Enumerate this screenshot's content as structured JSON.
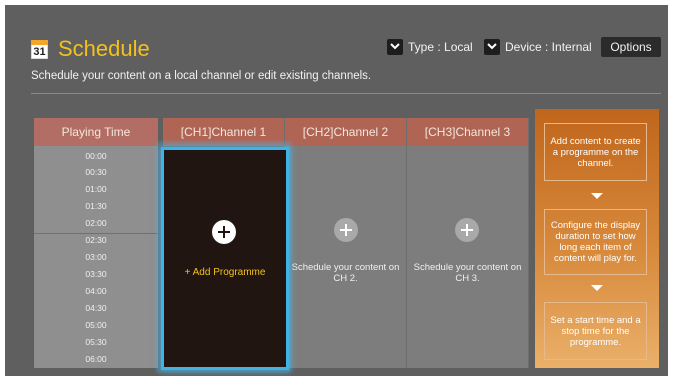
{
  "header": {
    "calendar_day": "31",
    "title": "Schedule",
    "subtitle": "Schedule your content on a local channel or edit existing channels."
  },
  "controls": {
    "type_label": "Type : Local",
    "device_label": "Device : Internal",
    "options_label": "Options"
  },
  "grid": {
    "time_header": "Playing Time",
    "times": [
      "00:00",
      "00:30",
      "01:00",
      "01:30",
      "02:00",
      "02:30",
      "03:00",
      "03:30",
      "04:00",
      "04:30",
      "05:00",
      "05:30",
      "06:00"
    ],
    "channels": [
      {
        "header": "[CH1]Channel 1",
        "text": "+ Add Programme"
      },
      {
        "header": "[CH2]Channel 2",
        "text": "Schedule your content on CH 2."
      },
      {
        "header": "[CH3]Channel 3",
        "text": "Schedule your content on CH 3."
      }
    ]
  },
  "help": {
    "steps": [
      "Add content to create a programme on the channel.",
      "Configure the display duration to set how long each item of content will play for.",
      "Set a start time and a stop time for the programme."
    ]
  },
  "colors": {
    "title": "#f2c11c",
    "background": "#5f5f5f",
    "selection_border": "#3fb3e5",
    "help_panel": "#d88a3c"
  }
}
